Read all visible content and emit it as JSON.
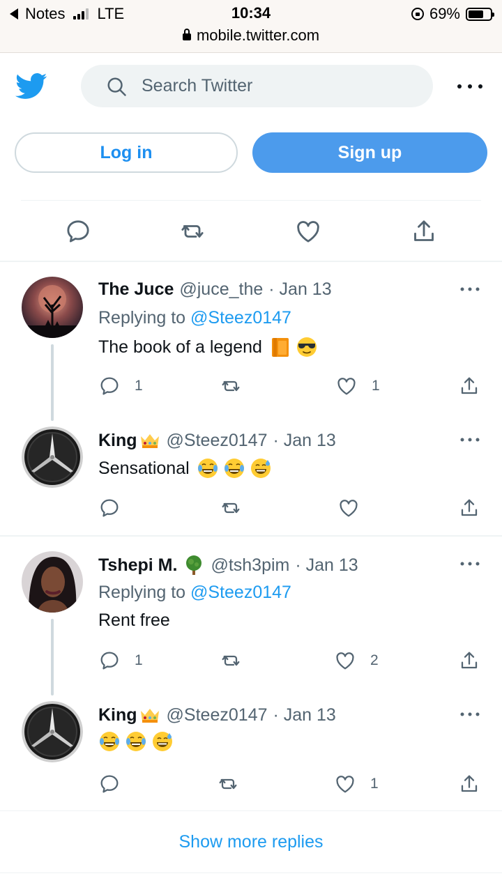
{
  "status_bar": {
    "back_app": "Notes",
    "network": "LTE",
    "time": "10:34",
    "battery": "69%",
    "battery_level": 0.69
  },
  "url_bar": {
    "domain": "mobile.twitter.com"
  },
  "header": {
    "search_placeholder": "Search Twitter",
    "login_label": "Log in",
    "signup_label": "Sign up"
  },
  "colors": {
    "accent": "#1d9bf0",
    "signup_bg": "#4c9bec",
    "muted": "#536471",
    "border": "#eff3f4"
  },
  "replies": [
    {
      "name": "The Juce",
      "handle": "@juce_the",
      "date": "· Jan 13",
      "replying_prefix": "Replying to",
      "replying_to": "@Steez0147",
      "text": "The book of a legend",
      "emojis": [
        "orange-book-emoji",
        "sunglasses-emoji"
      ],
      "reply_count": "1",
      "retweet_count": "",
      "like_count": "1"
    },
    {
      "name": "King",
      "name_badge": "crown-emoji",
      "handle": "@Steez0147",
      "date": "· Jan 13",
      "text": "Sensational",
      "emojis": [
        "tears-of-joy-emoji",
        "tears-of-joy-emoji",
        "sweat-smile-emoji"
      ],
      "reply_count": "",
      "retweet_count": "",
      "like_count": ""
    },
    {
      "name": "Tshepi M.",
      "name_badge": "tree-emoji",
      "handle": "@tsh3pim",
      "date": "· Jan 13",
      "replying_prefix": "Replying to",
      "replying_to": "@Steez0147",
      "text": "Rent free",
      "reply_count": "1",
      "retweet_count": "",
      "like_count": "2"
    },
    {
      "name": "King",
      "name_badge": "crown-emoji",
      "handle": "@Steez0147",
      "date": "· Jan 13",
      "text": "",
      "emojis": [
        "tears-of-joy-emoji",
        "tears-of-joy-emoji",
        "sweat-smile-emoji"
      ],
      "reply_count": "",
      "retweet_count": "",
      "like_count": "1"
    }
  ],
  "show_more_label": "Show more replies"
}
